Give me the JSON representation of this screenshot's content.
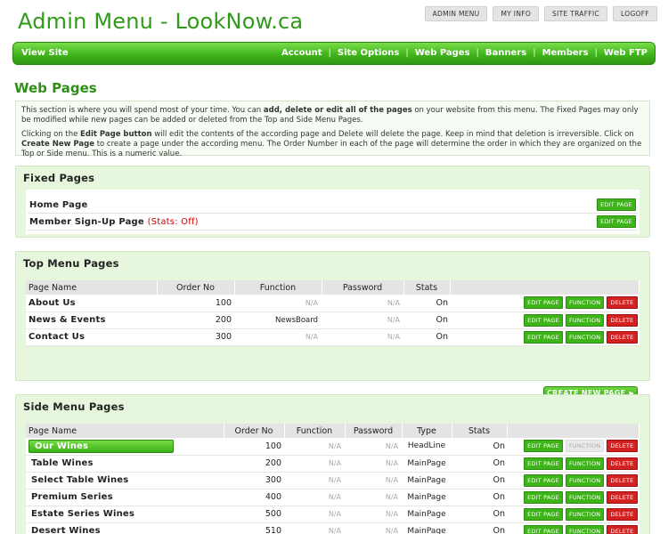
{
  "header": {
    "title": "Admin Menu - LookNow.ca",
    "top_links": [
      "ADMIN MENU",
      "MY INFO",
      "SITE TRAFFIC",
      "LOGOFF"
    ]
  },
  "nav": {
    "view_site": "View Site",
    "items": [
      "Account",
      "Site Options",
      "Web Pages",
      "Banners",
      "Members",
      "Web FTP"
    ],
    "separator": "|"
  },
  "page": {
    "heading": "Web Pages",
    "intro": {
      "p1_a": "This section is where you will spend most of your time. You can ",
      "p1_b": "add, delete or edit all of the pages",
      "p1_c": " on your website from this menu. The Fixed Pages may only be modified while new pages can be added or deleted from the Top and Side Menu Pages.",
      "p2_a": "Clicking on the ",
      "p2_b": "Edit Page button",
      "p2_c": " will edit the contents of the according page and Delete will delete the page. Keep in mind that deletion is irreversible. Click on ",
      "p2_d": "Create New Page",
      "p2_e": " to create a page under the according menu. The Order Number in each of the page will determine the order in which they are organized on the Top or Side menu. This is a numeric value."
    }
  },
  "buttons": {
    "edit": "EDIT PAGE",
    "function": "FUNCTION",
    "delete": "DELETE",
    "create": "CREATE NEW PAGE",
    "create_arrow": "▶"
  },
  "fixed": {
    "title": "Fixed Pages",
    "rows": [
      {
        "name": "Home Page",
        "note": ""
      },
      {
        "name": "Member Sign-Up Page",
        "note": "(Stats: Off)"
      }
    ]
  },
  "top": {
    "title": "Top Menu Pages",
    "headers": [
      "Page Name",
      "Order No",
      "Function",
      "Password",
      "Stats"
    ],
    "rows": [
      {
        "name": "About Us",
        "order": "100",
        "function": "N/A",
        "password": "N/A",
        "stats": "On"
      },
      {
        "name": "News & Events",
        "order": "200",
        "function": "NewsBoard",
        "password": "N/A",
        "stats": "On"
      },
      {
        "name": "Contact Us",
        "order": "300",
        "function": "N/A",
        "password": "N/A",
        "stats": "On"
      }
    ]
  },
  "side": {
    "title": "Side Menu Pages",
    "headers": [
      "Page Name",
      "Order No",
      "Function",
      "Password",
      "Type",
      "Stats"
    ],
    "rows": [
      {
        "name": "Our Wines",
        "order": "100",
        "function": "N/A",
        "password": "N/A",
        "type": "HeadLine",
        "stats": "On"
      },
      {
        "name": "Table Wines",
        "order": "200",
        "function": "N/A",
        "password": "N/A",
        "type": "MainPage",
        "stats": "On"
      },
      {
        "name": "Select Table Wines",
        "order": "300",
        "function": "N/A",
        "password": "N/A",
        "type": "MainPage",
        "stats": "On"
      },
      {
        "name": "Premium Series",
        "order": "400",
        "function": "N/A",
        "password": "N/A",
        "type": "MainPage",
        "stats": "On"
      },
      {
        "name": "Estate Series Wines",
        "order": "500",
        "function": "N/A",
        "password": "N/A",
        "type": "MainPage",
        "stats": "On"
      },
      {
        "name": "Desert Wines",
        "order": "510",
        "function": "N/A",
        "password": "N/A",
        "type": "MainPage",
        "stats": "On"
      }
    ]
  },
  "colors": {
    "brand_green": "#2f9b19",
    "nav_green": "#41b51b",
    "panel_bg": "#e6f7dd",
    "delete_red": "#d32020",
    "stats_off_red": "#d40000"
  }
}
